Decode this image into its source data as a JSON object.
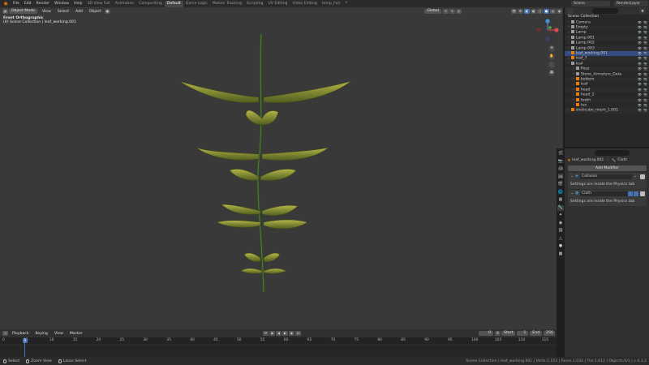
{
  "topbar": {
    "menus": [
      "File",
      "Edit",
      "Render",
      "Window",
      "Help"
    ],
    "workspaces": [
      "3D View Full",
      "Animation",
      "Compositing",
      "Default",
      "Game Logic",
      "Motion Tracking",
      "Scripting",
      "UV Editing",
      "Video Editing",
      "temp_Full"
    ],
    "active_workspace": "Default",
    "add_tab": "+",
    "scene": "Scene",
    "view_layer": "RenderLayer"
  },
  "viewport": {
    "mode": "Object Mode",
    "menus": [
      "View",
      "Select",
      "Add",
      "Object"
    ],
    "orientation": "Global",
    "view_name": "Front Orthographic",
    "collection_info": "(0) Scene Collection | leaf_working.001"
  },
  "outliner": {
    "title": "Scene Collection",
    "items": [
      {
        "label": "Camera",
        "color": "#9a9a9a",
        "indent": 0
      },
      {
        "label": "Empty",
        "color": "#9a9a9a",
        "indent": 0
      },
      {
        "label": "Lamp",
        "color": "#9a9a9a",
        "indent": 0
      },
      {
        "label": "Lamp.001",
        "color": "#9a9a9a",
        "indent": 0
      },
      {
        "label": "Lamp.002",
        "color": "#9a9a9a",
        "indent": 0
      },
      {
        "label": "Lamp.003",
        "color": "#9a9a9a",
        "indent": 0
      },
      {
        "label": "leaf_working.001",
        "color": "#e87d0d",
        "indent": 0,
        "selected": true
      },
      {
        "label": "leaf_7",
        "color": "#e87d0d",
        "indent": 0
      },
      {
        "label": "leaf",
        "color": "#9a9a9a",
        "indent": 0
      },
      {
        "label": "Pose",
        "color": "#9a9a9a",
        "indent": 1
      },
      {
        "label": "Stone_Armature_Data",
        "color": "#9a9a9a",
        "indent": 1
      },
      {
        "label": "bottom",
        "color": "#e87d0d",
        "indent": 1
      },
      {
        "label": "leaf",
        "color": "#e87d0d",
        "indent": 1
      },
      {
        "label": "head",
        "color": "#e87d0d",
        "indent": 1
      },
      {
        "label": "head_2",
        "color": "#e87d0d",
        "indent": 1
      },
      {
        "label": "tooth",
        "color": "#e87d0d",
        "indent": 1
      },
      {
        "label": "tux",
        "color": "#e87d0d",
        "indent": 1
      },
      {
        "label": "shelicube_mesh_1.001",
        "color": "#e87d0d",
        "indent": 0
      }
    ]
  },
  "properties": {
    "object_name": "leaf_working.001",
    "modifier_name": "Cloth",
    "add_modifier": "Add Modifier",
    "modifiers": [
      {
        "name": "Collision",
        "note": "Settings are inside the Physics tab"
      },
      {
        "name": "Cloth",
        "note": "Settings are inside the Physics tab"
      }
    ]
  },
  "timeline": {
    "menus": [
      "Playback",
      "Keying",
      "View",
      "Marker"
    ],
    "current_frame": "0",
    "start_label": "Start",
    "start_value": "1",
    "end_label": "End",
    "end_value": "250",
    "ruler": [
      "0",
      "5",
      "10",
      "15",
      "20",
      "25",
      "30",
      "35",
      "40",
      "45",
      "50",
      "55",
      "60",
      "65",
      "70",
      "75",
      "80",
      "85",
      "90",
      "95",
      "100",
      "105",
      "110",
      "115"
    ],
    "current_marker": "0"
  },
  "statusbar": {
    "select": "Select",
    "zoom": "Zoom View",
    "lasso": "Lasso Select",
    "stats": "Scene Collection | leaf_working.001 | Verts:1,153 | Faces:1,032 | Tris:1,612 | Objects:0/1 | v 4.3.2"
  },
  "colors": {
    "accent": "#4772b3",
    "object_orange": "#e87d0d",
    "leaf_green": "#8a9a34",
    "stem_green": "#3d5a2a"
  }
}
